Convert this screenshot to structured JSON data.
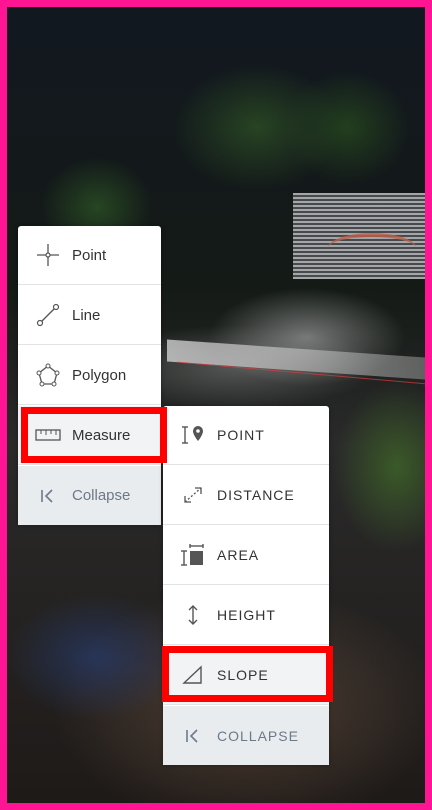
{
  "viewer": {
    "frame_color": "#ff1493",
    "highlight_color": "#ff0000"
  },
  "tools_menu": {
    "items": [
      {
        "label": "Point",
        "icon": "crosshair-icon"
      },
      {
        "label": "Line",
        "icon": "line-segment-icon"
      },
      {
        "label": "Polygon",
        "icon": "polygon-icon"
      },
      {
        "label": "Measure",
        "icon": "ruler-icon",
        "selected": true
      },
      {
        "label": "Collapse",
        "icon": "collapse-left-icon"
      }
    ]
  },
  "measure_menu": {
    "items": [
      {
        "label": "POINT",
        "icon": "point-marker-icon"
      },
      {
        "label": "DISTANCE",
        "icon": "distance-icon"
      },
      {
        "label": "AREA",
        "icon": "area-icon"
      },
      {
        "label": "HEIGHT",
        "icon": "height-arrow-icon"
      },
      {
        "label": "SLOPE",
        "icon": "slope-triangle-icon",
        "selected": true
      },
      {
        "label": "COLLAPSE",
        "icon": "collapse-left-icon"
      }
    ]
  }
}
